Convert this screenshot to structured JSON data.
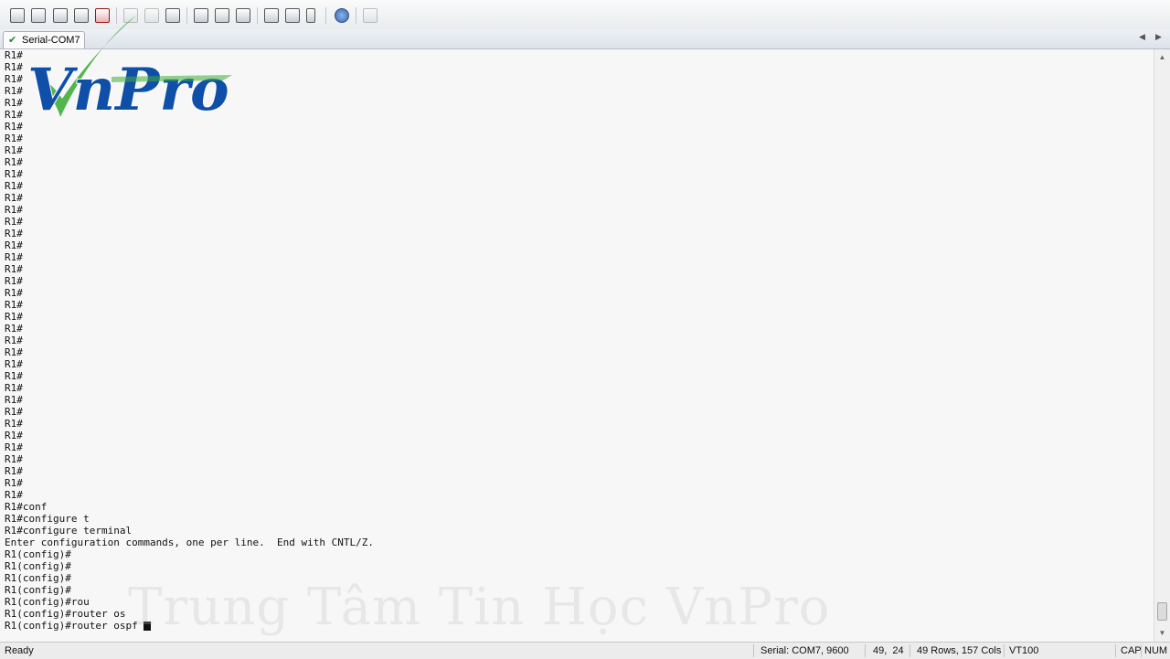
{
  "toolbar": {
    "icons": [
      "new-session-icon",
      "clone-session-icon",
      "open-session-icon",
      "quick-connect-icon",
      "disconnect-icon",
      "copy-icon",
      "paste-icon",
      "find-icon",
      "print-icon",
      "print-setup-icon",
      "print-screen-icon",
      "session-options-icon",
      "global-options-icon",
      "keymap-icon",
      "help-icon",
      "sftp-icon"
    ]
  },
  "tabs": [
    {
      "label": "Serial-COM7",
      "status": "connected"
    }
  ],
  "terminal": {
    "lines": [
      "R1#",
      "R1#",
      "R1#",
      "R1#",
      "R1#",
      "R1#",
      "R1#",
      "R1#",
      "R1#",
      "R1#",
      "R1#",
      "R1#",
      "R1#",
      "R1#",
      "R1#",
      "R1#",
      "R1#",
      "R1#",
      "R1#",
      "R1#",
      "R1#",
      "R1#",
      "R1#",
      "R1#",
      "R1#",
      "R1#",
      "R1#",
      "R1#",
      "R1#",
      "R1#",
      "R1#",
      "R1#",
      "R1#",
      "R1#",
      "R1#",
      "R1#",
      "R1#",
      "R1#",
      "R1#conf",
      "R1#configure t",
      "R1#configure terminal",
      "Enter configuration commands, one per line.  End with CNTL/Z.",
      "R1(config)#",
      "R1(config)#",
      "R1(config)#",
      "R1(config)#",
      "R1(config)#rou",
      "R1(config)#router os",
      "R1(config)#router ospf "
    ]
  },
  "logo": {
    "text": "VnPro"
  },
  "watermark": {
    "text": "Trung Tâm Tin Học VnPro"
  },
  "statusbar": {
    "ready": "Ready",
    "connection": "Serial: COM7, 9600",
    "cursor": "49,  24",
    "size": "49 Rows, 157 Cols",
    "emulation": "VT100",
    "cap": "CAP",
    "num": "NUM"
  },
  "colors": {
    "accent": "#1d8a2b",
    "logo_blue": "#0f4fa8",
    "logo_green": "#3fae3a"
  }
}
